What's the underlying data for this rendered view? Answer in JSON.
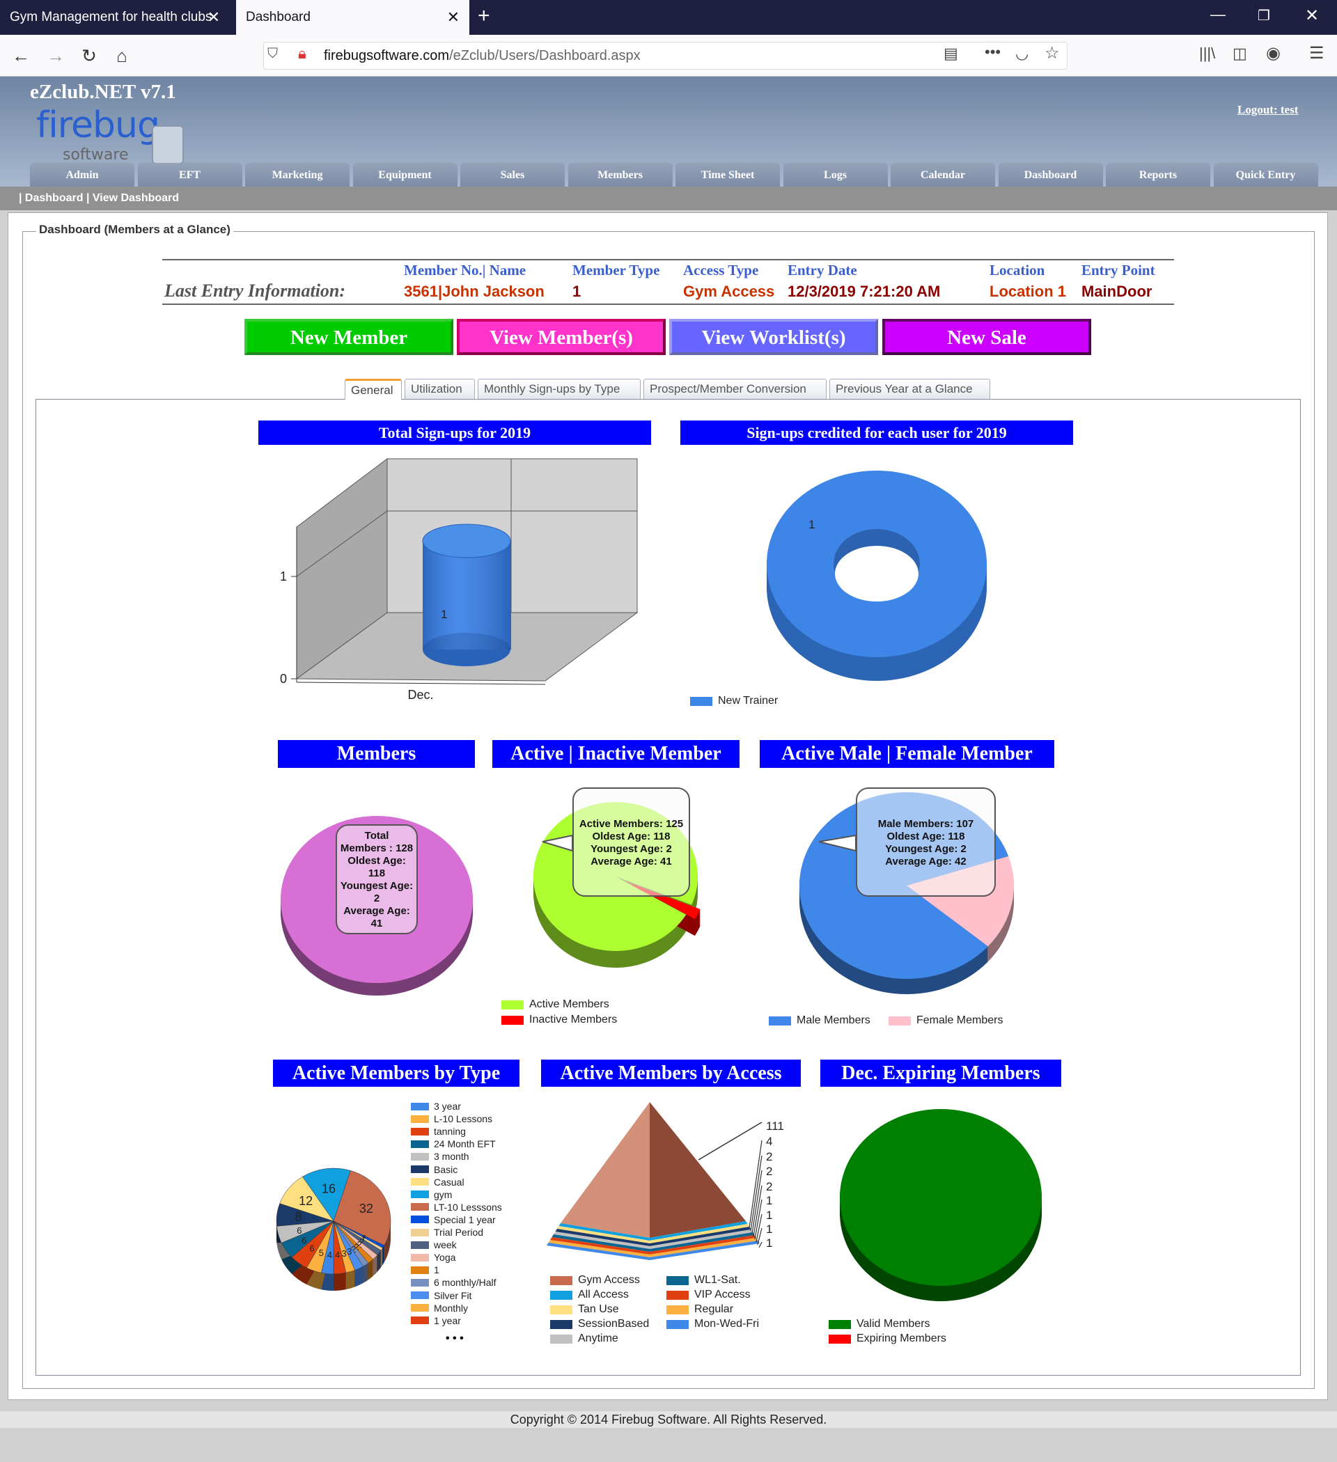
{
  "browser": {
    "tabs": [
      {
        "title": "Gym Management for health clubs"
      },
      {
        "title": "Dashboard"
      }
    ],
    "url_domain": "firebugsoftware.com",
    "url_path": "/eZclub/Users/Dashboard.aspx"
  },
  "header": {
    "app_title": "eZclub.NET v7.1",
    "logo_text": "firebug",
    "logo_sub": "software",
    "logout": "Logout: test",
    "nav": [
      "Admin",
      "EFT",
      "Marketing",
      "Equipment",
      "Sales",
      "Members",
      "Time Sheet",
      "Logs",
      "Calendar",
      "Dashboard",
      "Reports",
      "Quick Entry"
    ]
  },
  "breadcrumb": "| Dashboard | View Dashboard",
  "fieldset_title": "Dashboard (Members at a Glance)",
  "last_entry": {
    "label": "Last Entry Information:",
    "headers": [
      "Member No.| Name",
      "Member Type",
      "Access Type",
      "Entry Date",
      "Location",
      "Entry Point"
    ],
    "values": [
      "3561|John Jackson",
      "1",
      "Gym Access",
      "12/3/2019 7:21:20 AM",
      "Location 1",
      "MainDoor"
    ]
  },
  "buttons": [
    "New Member",
    "View Member(s)",
    "View Worklist(s)",
    "New Sale"
  ],
  "tabs": [
    "General",
    "Utilization",
    "Monthly Sign-ups by Type",
    "Prospect/Member Conversion",
    "Previous Year at a Glance"
  ],
  "active_tab": "General",
  "tooltips": {
    "members": [
      "Total",
      "Members : 128",
      "Oldest Age:",
      "118",
      "Youngest Age:",
      "2",
      "Average Age:",
      "41"
    ],
    "active": [
      "Active Members: 125",
      "Oldest Age: 118",
      "Youngest Age: 2",
      "Average Age: 41"
    ],
    "male": [
      "Male Members: 107",
      "Oldest Age: 118",
      "Youngest Age: 2",
      "Average Age: 42"
    ]
  },
  "more_indicator": "• • •",
  "footer": "Copyright © 2014 Firebug Software. All Rights Reserved.",
  "chart_data": [
    {
      "type": "bar",
      "title": "Total Sign-ups for 2019",
      "categories": [
        "Dec."
      ],
      "values": [
        1
      ],
      "yticks": [
        "0",
        "1"
      ],
      "ylim": [
        0,
        1
      ],
      "color": "#3b7fe0",
      "three_d": true
    },
    {
      "type": "pie",
      "title": "Sign-ups credited for each user for 2019",
      "donut": true,
      "slices": [
        {
          "label": "New Trainer",
          "value": 1,
          "color": "#3d85e6"
        }
      ]
    },
    {
      "type": "pie",
      "title": "Members",
      "slices": [
        {
          "label": "Total Members",
          "value": 128,
          "color": "#d86fd4"
        }
      ]
    },
    {
      "type": "pie",
      "title": "Active | Inactive Member",
      "slices": [
        {
          "label": "Active Members",
          "value": 125,
          "color": "#adff2f"
        },
        {
          "label": "Inactive Members",
          "value": 3,
          "color": "#ff0000"
        }
      ]
    },
    {
      "type": "pie",
      "title": "Active Male | Female Member",
      "slices": [
        {
          "label": "Male Members",
          "value": 107,
          "color": "#3f88ea"
        },
        {
          "label": "Female Members",
          "value": 21,
          "color": "#ffc0cb"
        }
      ]
    },
    {
      "type": "pie",
      "title": "Active Members by Type",
      "slices": [
        {
          "label": "3 year",
          "value": 4,
          "color": "#4088e8"
        },
        {
          "label": "L-10 Lessons",
          "value": 5,
          "color": "#fbb040"
        },
        {
          "label": "tanning",
          "value": 6,
          "color": "#e04010"
        },
        {
          "label": "24 Month EFT",
          "value": 6,
          "color": "#0a6690"
        },
        {
          "label": "3 month",
          "value": 6,
          "color": "#c0c0c0"
        },
        {
          "label": "Basic",
          "value": 8,
          "color": "#1b3a6a"
        },
        {
          "label": "Casual",
          "value": 12,
          "color": "#ffe080"
        },
        {
          "label": "gym",
          "value": 16,
          "color": "#10a0e0"
        },
        {
          "label": "LT-10 Lesssons",
          "value": 32,
          "color": "#c86a4c"
        },
        {
          "label": "Special 1 year",
          "value": 1,
          "color": "#0050e0"
        },
        {
          "label": "Trial Period",
          "value": 1,
          "color": "#f0d090"
        },
        {
          "label": "week",
          "value": 2,
          "color": "#506080"
        },
        {
          "label": "Yoga",
          "value": 2,
          "color": "#f0b8a8"
        },
        {
          "label": "1",
          "value": 2,
          "color": "#e08010"
        },
        {
          "label": "6 monthly/Half",
          "value": 2,
          "color": "#7890c0"
        },
        {
          "label": "Silver Fit",
          "value": 3,
          "color": "#4a8ef0"
        },
        {
          "label": "Monthly",
          "value": 3,
          "color": "#fbb040"
        },
        {
          "label": "1 year",
          "value": 4,
          "color": "#e04010"
        }
      ]
    },
    {
      "type": "pyramid",
      "title": "Active Members by Access",
      "slices": [
        {
          "label": "Gym Access",
          "value": 111,
          "color": "#c86a4c"
        },
        {
          "label": "All Access",
          "value": 4,
          "color": "#10a0e0"
        },
        {
          "label": "Tan Use",
          "value": 2,
          "color": "#ffe080"
        },
        {
          "label": "SessionBased",
          "value": 2,
          "color": "#1b3a6a"
        },
        {
          "label": "Anytime",
          "value": 2,
          "color": "#c0c0c0"
        },
        {
          "label": "WL1-Sat.",
          "value": 1,
          "color": "#0a6690"
        },
        {
          "label": "VIP Access",
          "value": 1,
          "color": "#e04010"
        },
        {
          "label": "Regular",
          "value": 1,
          "color": "#fbb040"
        },
        {
          "label": "Mon-Wed-Fri",
          "value": 1,
          "color": "#4088e8"
        }
      ]
    },
    {
      "type": "pie",
      "title": "Dec. Expiring Members",
      "slices": [
        {
          "label": "Valid Members",
          "value": 1,
          "color": "#008000"
        },
        {
          "label": "Expiring Members",
          "value": 0,
          "color": "#ff0000"
        }
      ]
    }
  ]
}
